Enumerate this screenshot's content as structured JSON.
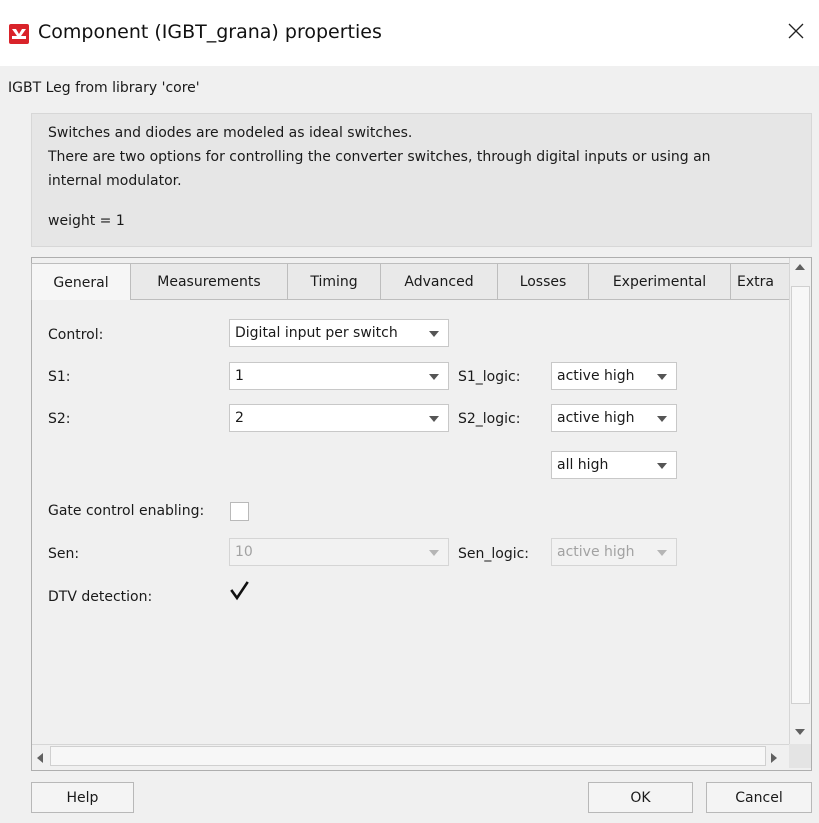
{
  "window": {
    "title": "Component (IGBT_grana) properties",
    "icon": "plecs-logo-icon",
    "close": "×"
  },
  "subtitle": "IGBT Leg from library 'core'",
  "description": {
    "lines": [
      "Switches and diodes are modeled as ideal switches.",
      "There are two options for controlling the converter switches, through digital inputs or using an",
      "internal modulator.",
      "",
      "weight = 1"
    ]
  },
  "tabs": [
    {
      "label": "General",
      "active": true
    },
    {
      "label": "Measurements",
      "active": false
    },
    {
      "label": "Timing",
      "active": false
    },
    {
      "label": "Advanced",
      "active": false
    },
    {
      "label": "Losses",
      "active": false
    },
    {
      "label": "Experimental",
      "active": false
    },
    {
      "label": "Extra",
      "active": false
    }
  ],
  "form": {
    "control": {
      "label": "Control:",
      "value": "Digital input per switch"
    },
    "s1": {
      "label": "S1:",
      "value": "1",
      "logic_label": "S1_logic:",
      "logic_value": "active high"
    },
    "s2": {
      "label": "S2:",
      "value": "2",
      "logic_label": "S2_logic:",
      "logic_value": "active high"
    },
    "all_high": {
      "value": "all high"
    },
    "gate_control": {
      "label": "Gate control enabling:",
      "checked": false
    },
    "sen": {
      "label": "Sen:",
      "value": "10",
      "logic_label": "Sen_logic:",
      "logic_value": "active high",
      "disabled": true
    },
    "dtv": {
      "label": "DTV detection:",
      "checked": true
    }
  },
  "buttons": {
    "help": "Help",
    "ok": "OK",
    "cancel": "Cancel"
  }
}
